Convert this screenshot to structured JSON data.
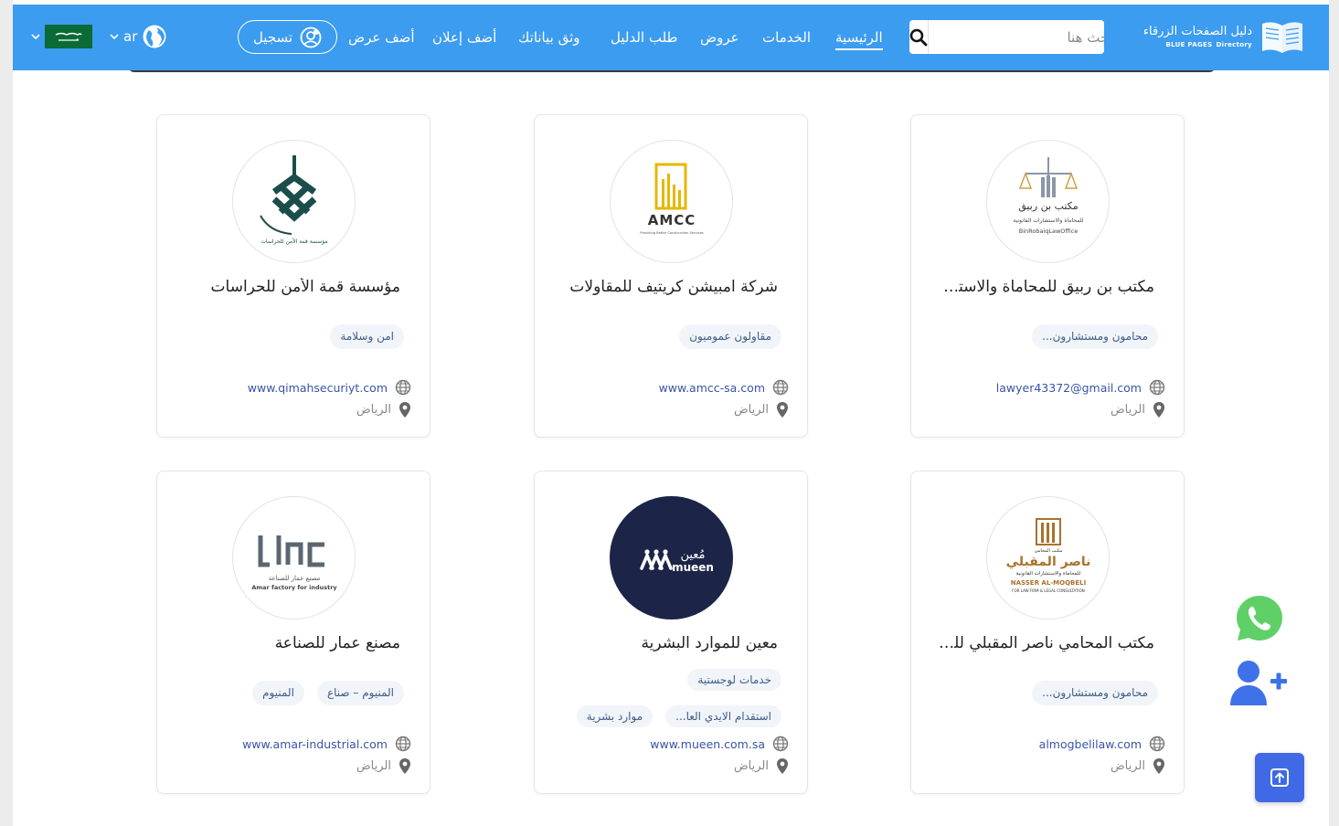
{
  "header": {
    "logo": {
      "ar": "دليل الصفحات الزرقاء",
      "en": "BLUE PAGES",
      "en_sub": "Directory"
    },
    "search": {
      "placeholder": "ابحث هنا"
    },
    "nav": [
      {
        "label": "الرئيسية",
        "active": true
      },
      {
        "label": "الخدمات"
      },
      {
        "label": "عروض"
      },
      {
        "label": "طلب الدليل"
      },
      {
        "label": "وثق بياناتك"
      },
      {
        "label": "أضف إعلان"
      },
      {
        "label": "أضف عرض"
      }
    ],
    "register_label": "تسجيل",
    "language": "ar"
  },
  "listings": [
    {
      "title": "مكتب بن ربيق للمحاماة والاستشارات القانونية",
      "logo": {
        "line1": "مكتب بن ربيق",
        "line2": "للمحاماة والاستشارات القانونية",
        "line3": "BinRobaiqLawOffice"
      },
      "tags": [
        "محامون ومستشارون..."
      ],
      "link": "lawyer43372@gmail.com",
      "city": "الرياض"
    },
    {
      "title": "شركة امبيشن كريتيف للمقاولات",
      "logo": {
        "line1": "AMCC",
        "line2": "Providing Better Construction Services"
      },
      "tags": [
        "مقاولون عموميون"
      ],
      "link": "www.amcc-sa.com",
      "city": "الرياض"
    },
    {
      "title": "مؤسسة قمة الأمن للحراسات",
      "logo": {
        "line1": "مؤسسة قمة الأمن للحراسات"
      },
      "tags": [
        "امن وسلامة"
      ],
      "link": "www.qimahsecuriyt.com",
      "city": "الرياض"
    },
    {
      "title": "مكتب المحامي ناصر المقبلي للمحاماة والاستشارات القانونية",
      "logo": {
        "line0": "مكتب المحامي",
        "line1": "ناصر المقبلي",
        "line2": "للمحاماة والاستشارات القانونية",
        "line3": "NASSER AL-MOQBELI",
        "line4": "FOR LAW FIRM & LEGAL CONSULTATION"
      },
      "tags": [
        "محامون ومستشارون..."
      ],
      "link": "almogbelilaw.com",
      "city": "الرياض"
    },
    {
      "title": "معين للموارد البشرية",
      "logo": {
        "line1": "مُعين",
        "line2": "mueen"
      },
      "tags": [
        "خدمات لوجستية",
        "استقدام الايدي العا...",
        "موارد بشرية"
      ],
      "link": "www.mueen.com.sa",
      "city": "الرياض"
    },
    {
      "title": "مصنع عمار للصناعة",
      "logo": {
        "line1": "مصنع عمار للصناعة",
        "line2": "Amar factory for industry"
      },
      "tags": [
        "المنيوم – صناع",
        "المنيوم"
      ],
      "link": "www.amar-industrial.com",
      "city": "الرياض"
    }
  ],
  "colors": {
    "nav_bg": "#3b9cf0",
    "tag_text": "#3e5d87",
    "link": "#3954a7",
    "whatsapp": "#5fd067",
    "add_user": "#3f72e8",
    "scroll_top": "#4069e6"
  },
  "icons": {
    "search": "search-icon",
    "globe": "globe-icon",
    "pin": "location-pin-icon",
    "whatsapp": "whatsapp-icon",
    "add_user": "user-plus-icon",
    "up": "arrow-up-icon"
  }
}
